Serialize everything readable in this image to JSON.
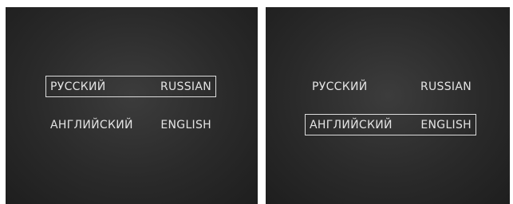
{
  "screens": [
    {
      "options": [
        {
          "native": "РУССКИЙ",
          "english": "RUSSIAN",
          "selected": true
        },
        {
          "native": "АНГЛИЙСКИЙ",
          "english": "ENGLISH",
          "selected": false
        }
      ]
    },
    {
      "options": [
        {
          "native": "РУССКИЙ",
          "english": "RUSSIAN",
          "selected": false
        },
        {
          "native": "АНГЛИЙСКИЙ",
          "english": "ENGLISH",
          "selected": true
        }
      ]
    }
  ]
}
